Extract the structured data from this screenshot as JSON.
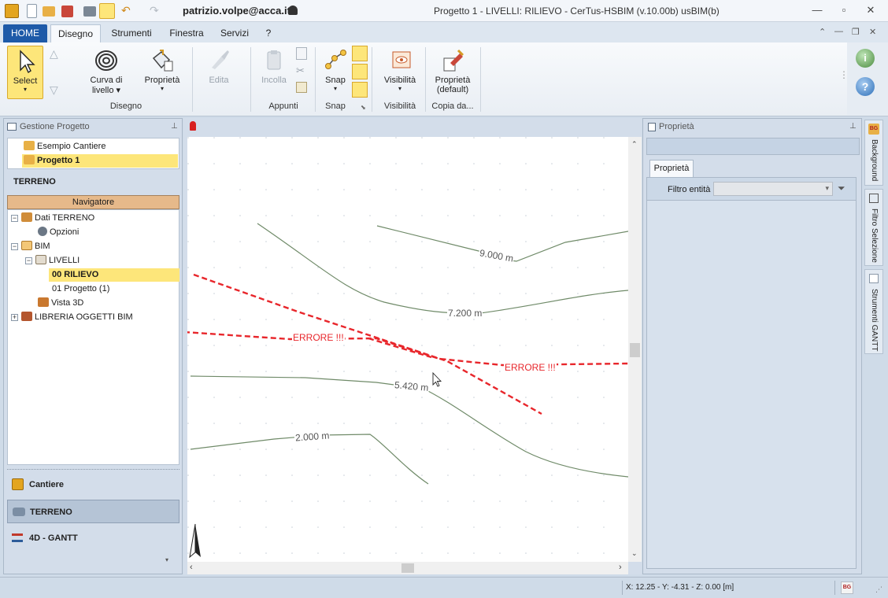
{
  "titlebar": {
    "user": "patrizio.volpe@acca.it",
    "title": "Progetto 1 -  LIVELLI: RILIEVO - CerTus-HSBIM (v.10.00b) usBIM(b)",
    "minimize_icon": "minimize-icon",
    "restore_icon": "restore-icon",
    "close_icon": "close-icon"
  },
  "tabs": [
    {
      "label": "HOME"
    },
    {
      "label": "Disegno"
    },
    {
      "label": "Strumenti"
    },
    {
      "label": "Finestra"
    },
    {
      "label": "Servizi"
    },
    {
      "label": "?"
    }
  ],
  "ribbon": {
    "select": {
      "label": "Select",
      "arrow": "▾"
    },
    "curva": {
      "label1": "Curva di",
      "label2": "livello ▾"
    },
    "proprieta": {
      "label": "Proprietà",
      "arrow": "▾"
    },
    "group_disegno": "Disegno",
    "edita": {
      "label": "Edita"
    },
    "incolla": {
      "label": "Incolla"
    },
    "group_appunti": "Appunti",
    "snap": {
      "label": "Snap",
      "arrow": "▾"
    },
    "group_snap": "Snap",
    "visibilita": {
      "label": "Visibilità",
      "arrow": "▾"
    },
    "group_visibilita": "Visibilità",
    "proprieta_default": {
      "label1": "Proprietà",
      "label2": "(default)"
    },
    "group_copia": "Copia da..."
  },
  "left_panel": {
    "header": "Gestione Progetto",
    "projects": [
      "Esempio Cantiere",
      "Progetto 1"
    ],
    "section_title": "TERRENO",
    "navigator_label": "Navigatore",
    "tree": {
      "dati": "Dati TERRENO",
      "opzioni": "Opzioni",
      "bim": "BIM",
      "livelli": "LIVELLI",
      "rilievo": "00 RILIEVO",
      "progetto": "01 Progetto (1)",
      "vista": "Vista 3D",
      "libreria": "LIBRERIA OGGETTI BIM"
    },
    "nav_buttons": [
      "Cantiere",
      "TERRENO",
      "4D - GANTT"
    ]
  },
  "canvas": {
    "contour_labels": [
      "9.000 m",
      "7.200 m",
      "5.420 m",
      "2.000 m"
    ],
    "error_labels": [
      "ERRORE !!!",
      "ERRORE !!!"
    ]
  },
  "right_panel": {
    "header": "Proprietà",
    "tab": "Proprietà",
    "filter_label": "Filtro entità",
    "filter_value": ""
  },
  "side_tabs": [
    "Background",
    "Filtro Selezione",
    "Strumenti GANTT"
  ],
  "statusbar": {
    "coords": "X: 12.25 - Y: -4.31 - Z: 0.00 [m]"
  },
  "colors": {
    "accent": "#1e5aa8",
    "selected": "#fde67a",
    "navigator": "#e6b98a",
    "error": "#e8262b",
    "contour": "#6f8a68"
  }
}
